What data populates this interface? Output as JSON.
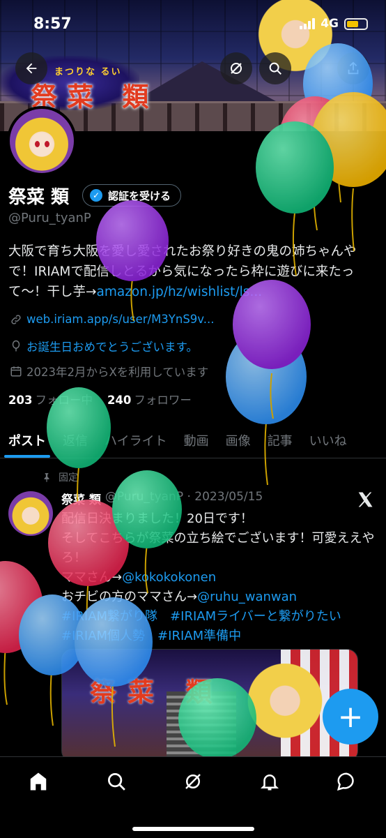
{
  "status_bar": {
    "time": "8:57",
    "network": "4G"
  },
  "banner": {
    "logo_small": "まつりな るい",
    "logo_big": "祭菜 類"
  },
  "profile": {
    "name": "祭菜 類",
    "verify_button": "認証を受ける",
    "handle": "@Puru_tyanP",
    "bio_text": "大阪で育ち大阪を愛し愛されたお祭り好きの鬼の姉ちゃんやで！IRIAMで配信しとるから気になったら枠に遊びに来たって〜！干し芋→",
    "bio_link": "amazon.jp/hz/wishlist/ls...",
    "website": "web.iriam.app/s/user/M3YnS9v...",
    "birthday": "お誕生日おめでとうございます。",
    "joined": "2023年2月からXを利用しています",
    "following_count": "203",
    "following_label": "フォロー中",
    "followers_count": "240",
    "followers_label": "フォロワー"
  },
  "tabs": [
    "ポスト",
    "返信",
    "ハイライト",
    "動画",
    "画像",
    "記事",
    "いいね"
  ],
  "post": {
    "pinned_label": "固定",
    "author": "祭菜 類",
    "handle_date": "@Puru_tyanP · 2023/05/15",
    "line1": "配信日決まりました！20日です！",
    "line2": "そしてこちらが祭菜の立ち絵でございます！可愛ええやろ！",
    "mama_prefix": "ママさん→",
    "mama_link": "@kokokokonen",
    "chibi_prefix": "おチビの方のママさん→",
    "chibi_link": "@ruhu_wanwan",
    "hashtags1": "#IRIAM繋がり隊　#IRIAMライバーと繋がりたい",
    "hashtags2": "#IRIAM個人勢　#IRIAM準備中",
    "image_logo": "祭菜 類"
  },
  "fab_label": "+",
  "colors": {
    "accent": "#1d9bf0",
    "background": "#000000",
    "secondary_text": "#71767b"
  },
  "icons": [
    "back-arrow-icon",
    "grok-icon",
    "search-icon",
    "share-icon",
    "verified-badge-icon",
    "link-icon",
    "balloon-icon",
    "calendar-icon",
    "pin-icon",
    "x-logo-icon",
    "compose-icon",
    "home-icon",
    "bell-icon",
    "message-icon"
  ]
}
